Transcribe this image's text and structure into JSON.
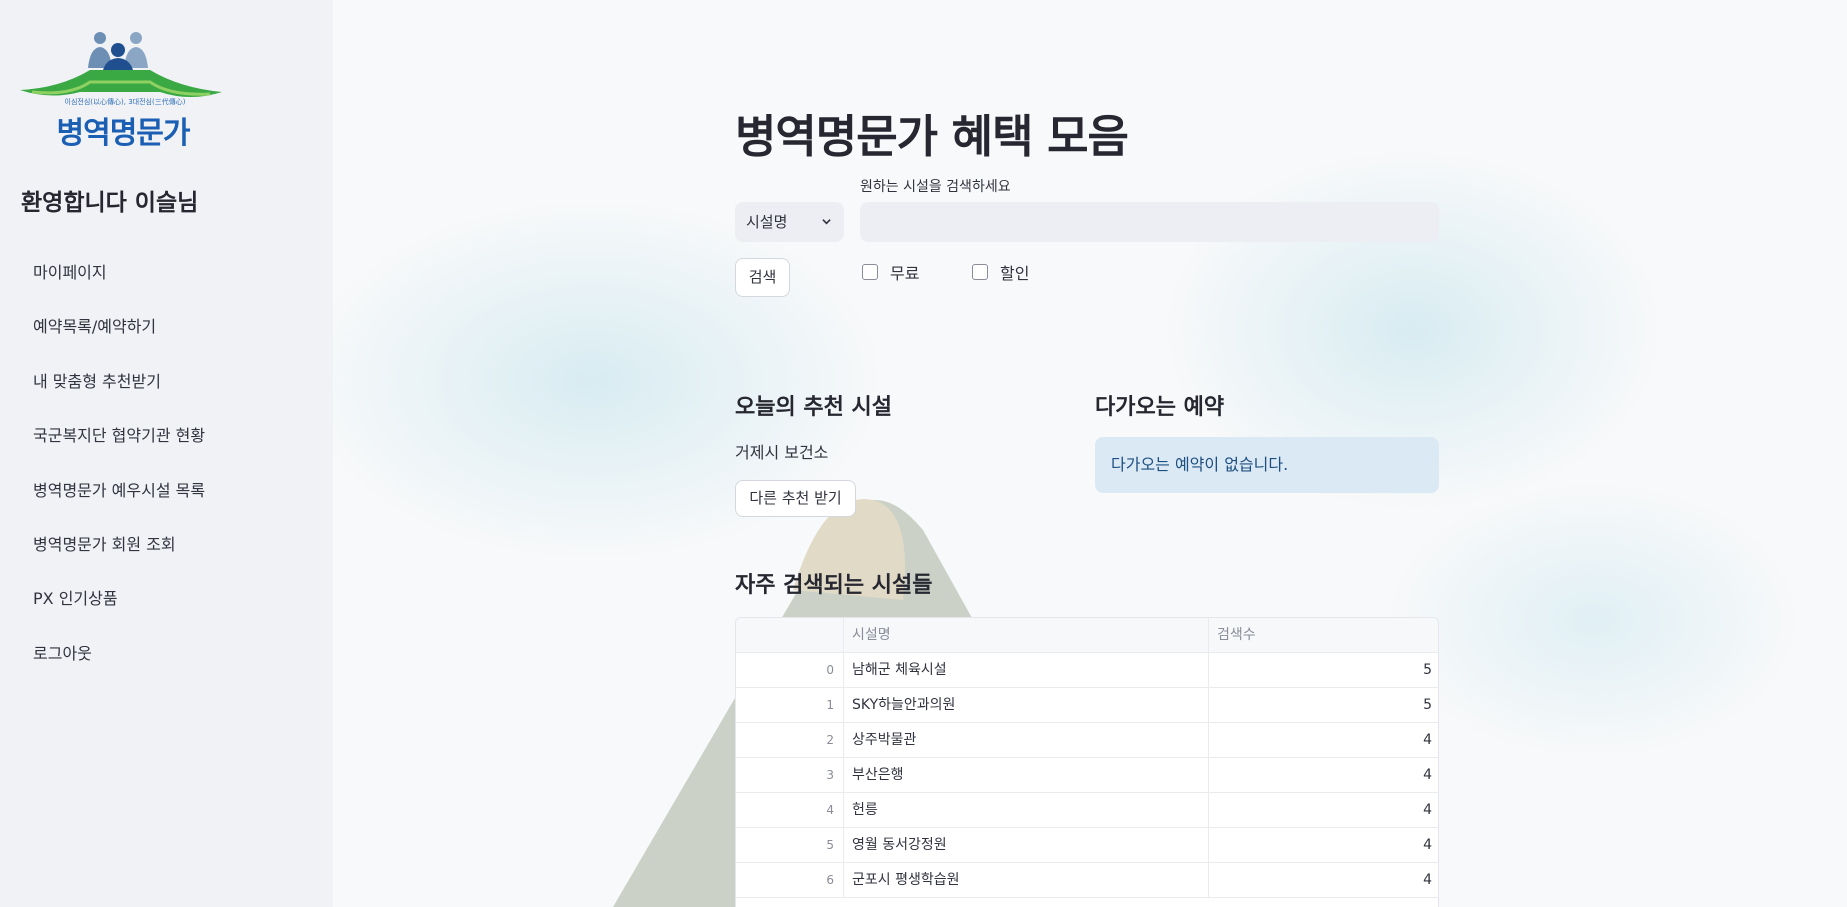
{
  "sidebar": {
    "logo": {
      "text": "병역명문가",
      "subtext": "이심전심(以心傳心), 3대전심(三代傳心)"
    },
    "welcome": "환영합니다 이슬님",
    "items": [
      {
        "label": "마이페이지"
      },
      {
        "label": "예약목록/예약하기"
      },
      {
        "label": "내 맞춤형 추천받기"
      },
      {
        "label": "국군복지단 협약기관 현황"
      },
      {
        "label": "병역명문가 예우시설 목록"
      },
      {
        "label": "병역명문가 회원 조회"
      },
      {
        "label": "PX 인기상품"
      },
      {
        "label": "로그아웃"
      }
    ]
  },
  "main": {
    "title": "병역명문가 혜택 모음",
    "search": {
      "select_value": "시설명",
      "label": "원하는 시설을 검색하세요",
      "value": "",
      "placeholder": "",
      "button": "검색",
      "checkbox_free": "무료",
      "checkbox_discount": "할인"
    },
    "recommend": {
      "heading": "오늘의 추천 시설",
      "facility": "거제시 보건소",
      "button": "다른 추천 받기"
    },
    "upcoming": {
      "heading": "다가오는 예약",
      "message": "다가오는 예약이 없습니다."
    },
    "popular": {
      "heading": "자주 검색되는 시설들",
      "columns": [
        "",
        "시설명",
        "검색수"
      ],
      "rows": [
        {
          "index": "0",
          "name": "남해군 체육시설",
          "count": "5"
        },
        {
          "index": "1",
          "name": "SKY하늘안과의원",
          "count": "5"
        },
        {
          "index": "2",
          "name": "상주박물관",
          "count": "4"
        },
        {
          "index": "3",
          "name": "부산은행",
          "count": "4"
        },
        {
          "index": "4",
          "name": "헌릉",
          "count": "4"
        },
        {
          "index": "5",
          "name": "영월 동서강정원",
          "count": "4"
        },
        {
          "index": "6",
          "name": "군포시 평생학습원",
          "count": "4"
        }
      ]
    }
  },
  "colors": {
    "sidebar_bg": "#f0f2f6",
    "brand_blue": "#1a5fb4",
    "brand_green": "#3aa843",
    "info_bg": "#dbe9f5"
  }
}
